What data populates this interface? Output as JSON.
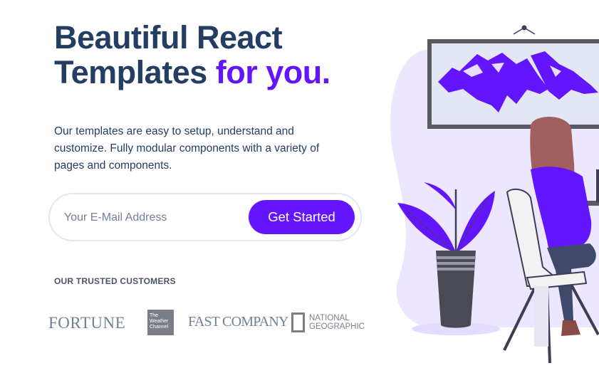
{
  "hero": {
    "headline_line1": "Beautiful React",
    "headline_line2_plain": "Templates ",
    "headline_line2_accent": "for you.",
    "description": "Our templates are easy to setup, understand and customize. Fully modular components with a variety of pages and components."
  },
  "signup": {
    "email_placeholder": "Your E-Mail Address",
    "cta_label": "Get Started"
  },
  "customers": {
    "heading": "OUR TRUSTED CUSTOMERS",
    "logos": {
      "fortune": "FORTUNE",
      "weather_line1": "The",
      "weather_line2": "Weather",
      "weather_line3": "Channel",
      "fastcompany": "FAST COMPANY",
      "natgeo_line1": "NATIONAL",
      "natgeo_line2": "GEOGRAPHIC"
    }
  },
  "colors": {
    "accent": "#6415ff",
    "heading": "#243e63",
    "muted": "#718096"
  }
}
